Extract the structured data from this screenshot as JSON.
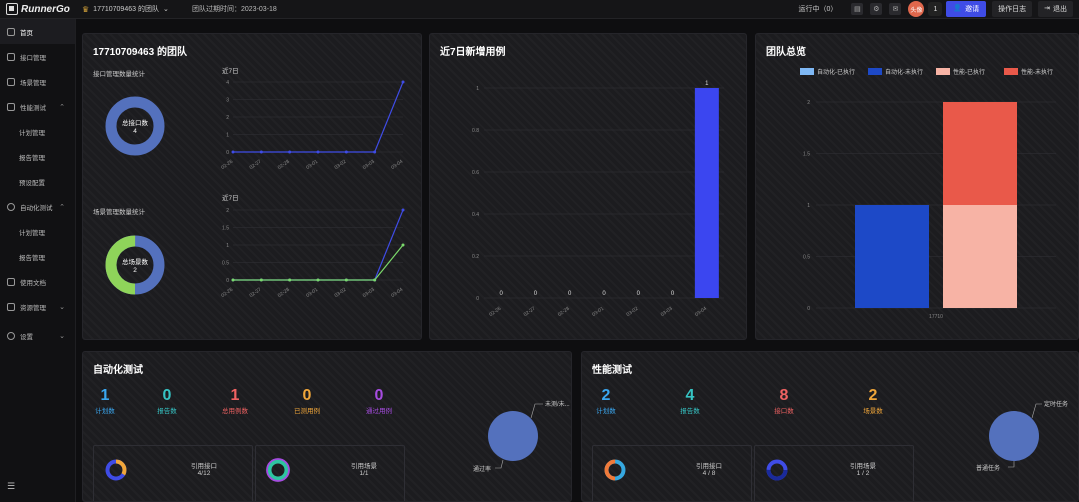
{
  "topbar": {
    "logo_text": "RunnerGo",
    "team_name": "17710709463 的团队",
    "expire_text": "团队过期时间：2023-03-18",
    "run_status": "运行中（0）",
    "avatar_text": "头像",
    "badge_count": "1",
    "invite_label": "邀请",
    "log_label": "操作日志",
    "logout_label": "退出"
  },
  "sidebar": {
    "items": [
      {
        "label": "首页"
      },
      {
        "label": "接口管理"
      },
      {
        "label": "场景管理"
      },
      {
        "label": "性能测试"
      },
      {
        "label": "计划管理"
      },
      {
        "label": "报告管理"
      },
      {
        "label": "预设配置"
      },
      {
        "label": "自动化测试"
      },
      {
        "label": "计划管理"
      },
      {
        "label": "报告管理"
      },
      {
        "label": "使用文档"
      },
      {
        "label": "资源管理"
      },
      {
        "label": "设置"
      }
    ]
  },
  "team_panel": {
    "title": "17710709463 的团队",
    "api_stat_title": "接口管理数量统计",
    "api_donut_label": "总接口数",
    "api_donut_value": "4",
    "api_line_title": "近7日",
    "scene_stat_title": "场景管理数量统计",
    "scene_donut_label": "总场景数",
    "scene_donut_value": "2",
    "scene_line_title": "近7日"
  },
  "chart_data": [
    {
      "type": "line",
      "title": "近7日",
      "x": [
        "02-26",
        "02-27",
        "02-28",
        "03-01",
        "03-02",
        "03-03",
        "03-04"
      ],
      "series": [
        {
          "values": [
            0,
            0,
            0,
            0,
            0,
            0,
            4
          ],
          "color": "#3f4ce6"
        }
      ],
      "ylim": [
        0,
        4
      ],
      "yticks": [
        "0",
        "1",
        "2",
        "3",
        "4"
      ]
    },
    {
      "type": "line",
      "title": "近7日",
      "x": [
        "02-26",
        "02-27",
        "02-28",
        "03-01",
        "03-02",
        "03-03",
        "03-04"
      ],
      "series": [
        {
          "values": [
            0,
            0,
            0,
            0,
            0,
            0,
            2
          ],
          "color": "#3f4ce6"
        },
        {
          "values": [
            0,
            0,
            0,
            0,
            0,
            0,
            1
          ],
          "color": "#7bd96b"
        }
      ],
      "ylim": [
        0,
        2
      ],
      "yticks": [
        "0",
        "0.5",
        "1",
        "1.5",
        "2"
      ]
    },
    {
      "type": "bar",
      "title": "近7日新增用例",
      "categories": [
        "02-26",
        "02-27",
        "02-28",
        "03-01",
        "03-02",
        "03-03",
        "03-04"
      ],
      "values": [
        0,
        0,
        0,
        0,
        0,
        0,
        1
      ],
      "ylim": [
        0,
        1
      ],
      "yticks": [
        "0",
        "0.2",
        "0.4",
        "0.6",
        "0.8",
        "1"
      ],
      "color": "#3b46f0"
    },
    {
      "type": "bar",
      "title": "团队总览",
      "categories": [
        "17710"
      ],
      "legend": [
        "自动化-已执行",
        "自动化-未执行",
        "性能-已执行",
        "性能-未执行"
      ],
      "legend_colors": [
        "#7fb8f5",
        "#1d49c7",
        "#f7b3a5",
        "#e9594a"
      ],
      "groups": [
        {
          "name": "自动化",
          "segments": [
            {
              "series": "自动化-已执行",
              "value": 0
            },
            {
              "series": "自动化-未执行",
              "value": 1
            }
          ]
        },
        {
          "name": "性能",
          "segments": [
            {
              "series": "性能-已执行",
              "value": 1
            },
            {
              "series": "性能-未执行",
              "value": 1
            }
          ]
        }
      ],
      "ylim": [
        0,
        2
      ],
      "yticks": [
        "0",
        "0.5",
        "1",
        "1.5",
        "2"
      ]
    }
  ],
  "auto_panel": {
    "title": "自动化测试",
    "stats": [
      {
        "value": "1",
        "label": "计划数",
        "color": "#3aa7f0"
      },
      {
        "value": "0",
        "label": "报告数",
        "color": "#36c4c4"
      },
      {
        "value": "1",
        "label": "总用例数",
        "color": "#f06262"
      },
      {
        "value": "0",
        "label": "已测用例",
        "color": "#f0a63a"
      },
      {
        "value": "0",
        "label": "通过用例",
        "color": "#a64ce0"
      }
    ],
    "pie_label_top": "未测/未...",
    "pie_label_bottom": "通过率",
    "card1_label": "引用接口",
    "card1_value": "4/12",
    "card2_label": "引用场景",
    "card2_value": "1/1"
  },
  "perf_panel": {
    "title": "性能测试",
    "stats": [
      {
        "value": "2",
        "label": "计划数",
        "color": "#3aa7f0"
      },
      {
        "value": "4",
        "label": "报告数",
        "color": "#36c4c4"
      },
      {
        "value": "8",
        "label": "接口数",
        "color": "#f06262"
      },
      {
        "value": "2",
        "label": "场景数",
        "color": "#f0a63a"
      }
    ],
    "pie_label_top": "定时任务",
    "pie_label_bottom": "普通任务",
    "card1_label": "引用接口",
    "card1_value": "4 / 8",
    "card2_label": "引用场景",
    "card2_value": "1 / 2"
  }
}
